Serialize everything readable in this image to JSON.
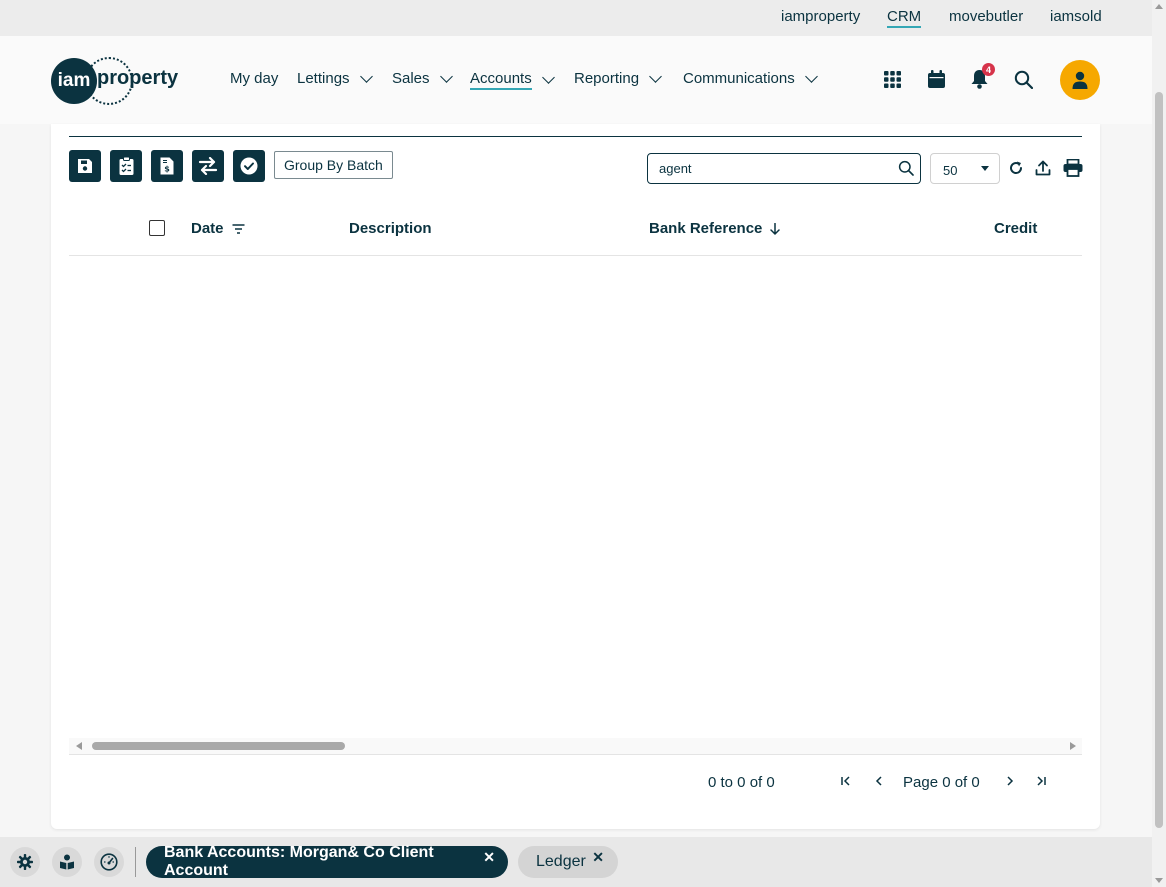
{
  "topbar": {
    "links": [
      "iamproperty",
      "CRM",
      "movebutler",
      "iamsold"
    ],
    "active": "CRM"
  },
  "logo": {
    "circle_text": "iam",
    "word": "property"
  },
  "nav": {
    "my_day": "My day",
    "lettings": "Lettings",
    "sales": "Sales",
    "accounts": "Accounts",
    "reporting": "Reporting",
    "communications": "Communications",
    "active": "Accounts"
  },
  "header_icons": {
    "apps": "grid-icon",
    "calendar": "calendar-icon",
    "notifications": "bell-icon",
    "notification_count": "4",
    "search": "search-icon",
    "avatar": "user-icon"
  },
  "toolbar": {
    "group_by_batch": "Group By Batch",
    "icons": [
      "save-icon",
      "clipboard-check-icon",
      "invoice-dollar-icon",
      "transfer-icon",
      "check-circle-icon"
    ]
  },
  "search": {
    "value": "agent"
  },
  "page_size": {
    "value": "50"
  },
  "table": {
    "columns": {
      "date": "Date",
      "description": "Description",
      "bank_reference": "Bank Reference",
      "credit": "Credit"
    },
    "rows": []
  },
  "pager": {
    "summary": "0 to 0 of 0",
    "page_text": "Page 0 of 0"
  },
  "footer": {
    "tabs": [
      {
        "label": "Bank Accounts: Morgan& Co Client Account",
        "active": true
      },
      {
        "label": "Ledger",
        "active": false
      }
    ]
  },
  "colors": {
    "brand_dark": "#0b3340",
    "accent_teal": "#35a7b5",
    "avatar_orange": "#f6a800",
    "badge_red": "#d6334a"
  }
}
